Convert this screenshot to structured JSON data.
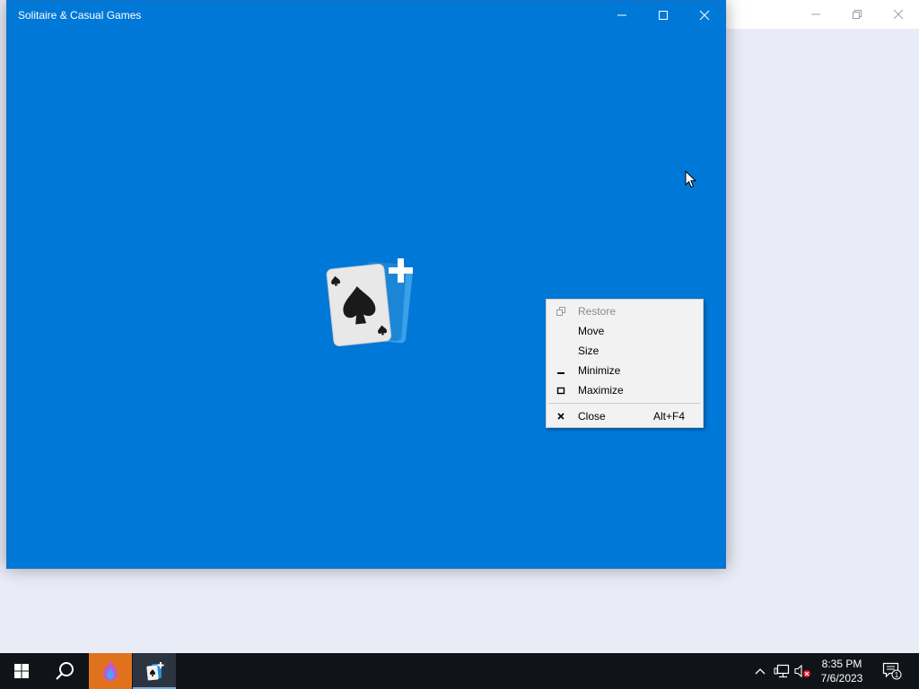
{
  "app": {
    "title": "Solitaire & Casual Games"
  },
  "context_menu": {
    "items": [
      {
        "label": "Restore",
        "icon": "restore-icon",
        "enabled": false,
        "shortcut": ""
      },
      {
        "label": "Move",
        "icon": "",
        "enabled": true,
        "shortcut": ""
      },
      {
        "label": "Size",
        "icon": "",
        "enabled": true,
        "shortcut": ""
      },
      {
        "label": "Minimize",
        "icon": "minimize-icon",
        "enabled": true,
        "shortcut": ""
      },
      {
        "label": "Maximize",
        "icon": "maximize-icon",
        "enabled": true,
        "shortcut": ""
      },
      {
        "label": "Close",
        "icon": "close-icon",
        "enabled": true,
        "shortcut": "Alt+F4"
      }
    ]
  },
  "taskbar": {
    "clock": {
      "time": "8:35 PM",
      "date": "7/6/2023"
    },
    "notification_count": "1",
    "tray_icons": [
      "chevron-up-icon",
      "network-icon",
      "volume-muted-icon"
    ],
    "pinned": [
      "start-icon",
      "search-icon",
      "orange-app-icon",
      "solitaire-app-icon"
    ]
  },
  "colors": {
    "window_accent": "#0078d7",
    "taskbar": "#101418",
    "desktop": "#e9ecf7",
    "menu_bg": "#f2f2f2"
  }
}
